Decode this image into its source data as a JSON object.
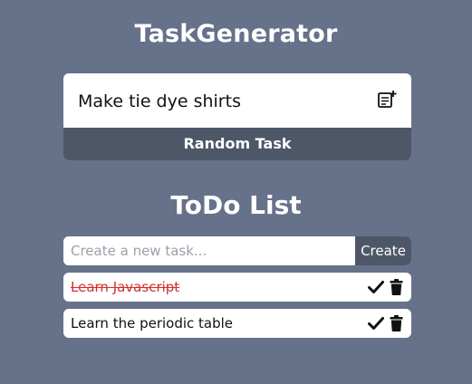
{
  "app": {
    "title": "TaskGenerator"
  },
  "generator": {
    "current_task": "Make tie dye shirts",
    "add_icon": "add-note-icon",
    "random_button_label": "Random Task"
  },
  "todo": {
    "title": "ToDo List",
    "input_placeholder": "Create a new task...",
    "input_value": "",
    "create_button_label": "Create",
    "tasks": [
      {
        "label": "Learn Javascript",
        "completed": true,
        "status_color": "#d32f2f"
      },
      {
        "label": "Learn the periodic table",
        "completed": false
      }
    ],
    "complete_icon": "check-icon",
    "delete_icon": "trash-icon"
  },
  "colors": {
    "background": "#66718a",
    "button": "#4e5768",
    "completed_text": "#d32f2f"
  }
}
